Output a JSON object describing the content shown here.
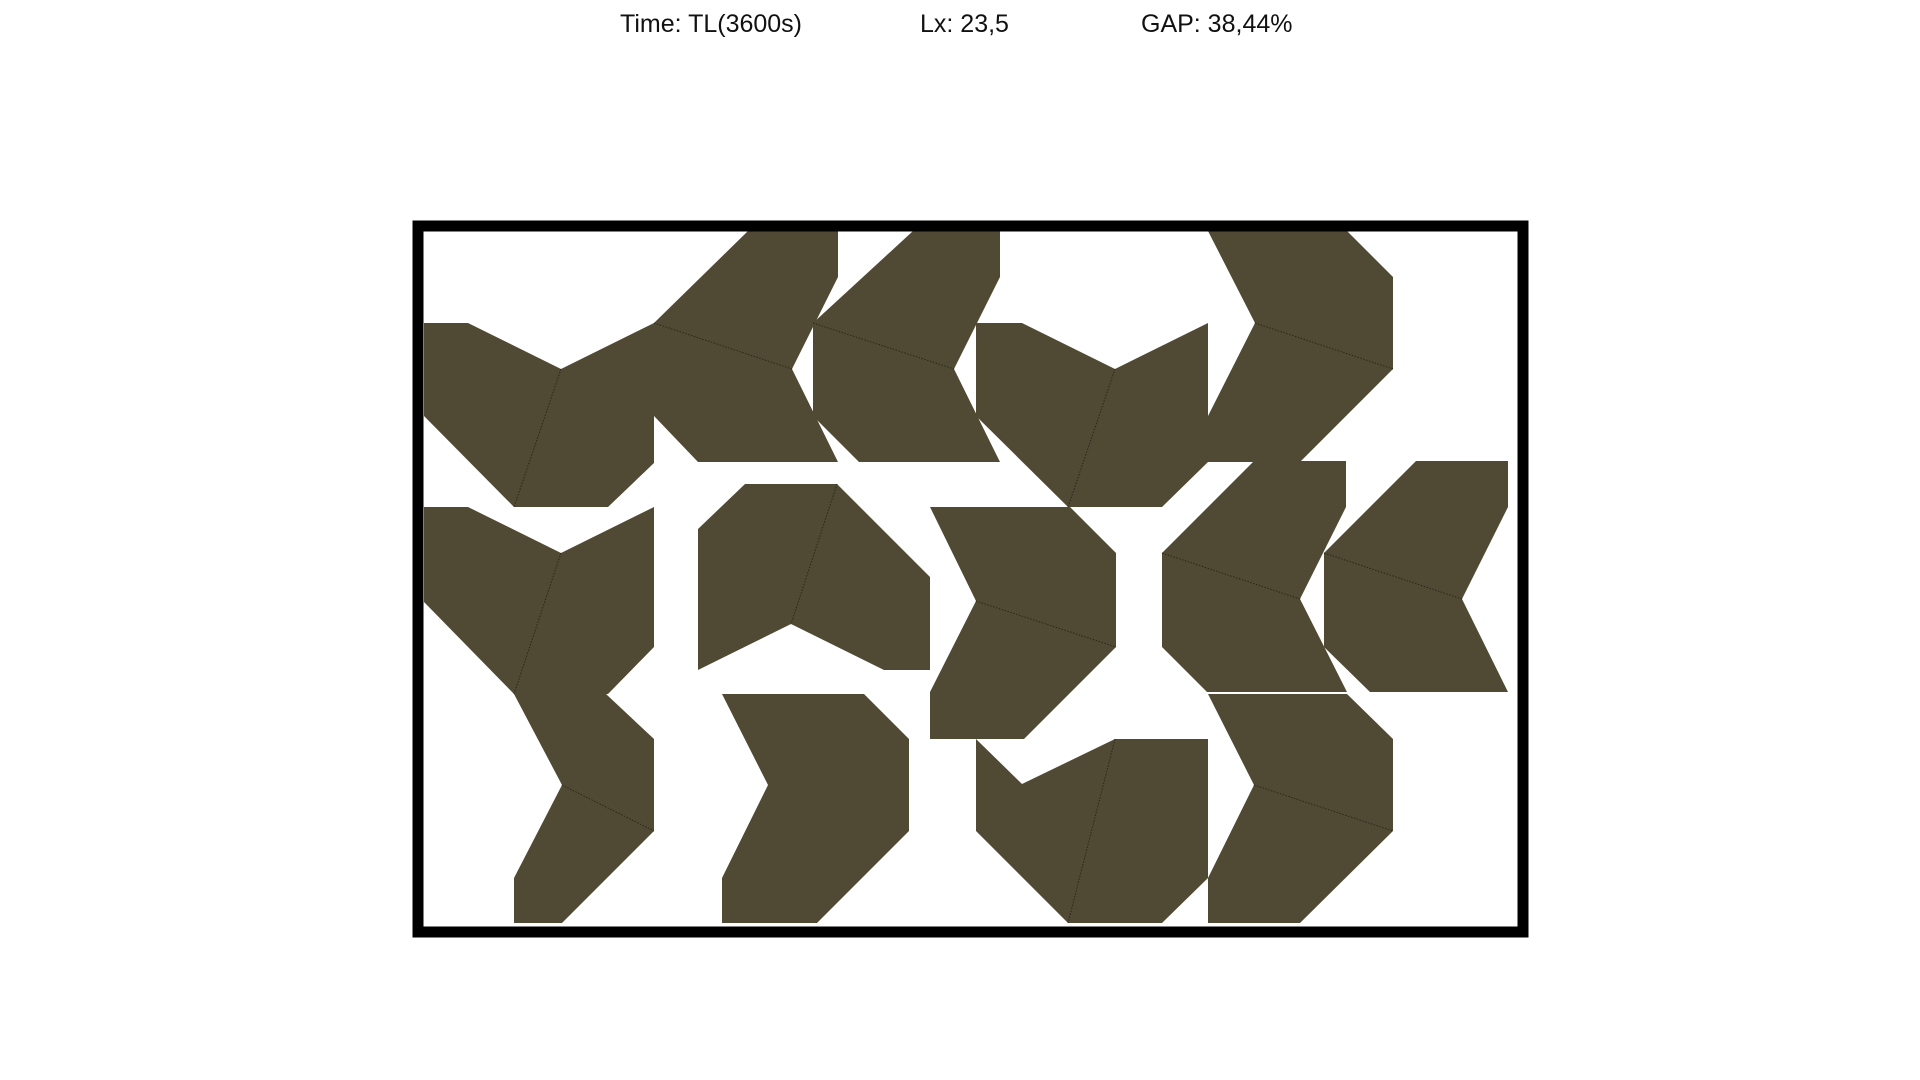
{
  "header": {
    "time": "Time: TL(3600s)",
    "lx": "Lx: 23,5",
    "gap": "GAP: 38,44%"
  },
  "colors": {
    "piece_fill": "#504A34",
    "piece_seam": "#2a2719",
    "frame": "#000000",
    "background": "#ffffff"
  }
}
